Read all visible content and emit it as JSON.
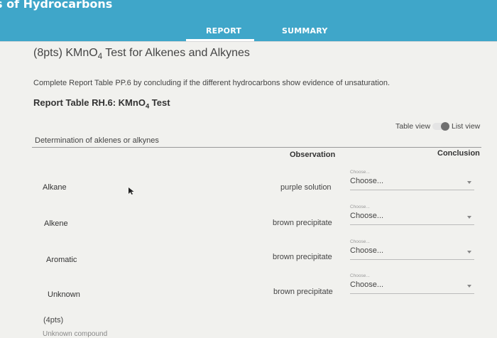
{
  "app": {
    "title": "s of Hydrocarbons"
  },
  "tabs": [
    {
      "label": "REPORT",
      "active": true
    },
    {
      "label": "SUMMARY",
      "active": false
    }
  ],
  "question": {
    "title_prefix": "(8pts) KMnO",
    "title_sub": "4",
    "title_suffix": " Test for Alkenes and Alkynes",
    "instruction": "Complete Report Table PP.6 by concluding if the different hydrocarbons show evidence of unsaturation."
  },
  "report_table": {
    "title_prefix": "Report Table RH.6: KMnO",
    "title_sub": "4",
    "title_suffix": " Test",
    "view_toggle": {
      "table_view_label": "Table view",
      "list_view_label": "List view"
    },
    "determination_label": "Determination of aklenes or alkynes",
    "columns": {
      "observation": "Observation",
      "conclusion": "Conclusion"
    },
    "rows": [
      {
        "label": "Alkane",
        "observation": "purple solution",
        "select_hint": "Choose...",
        "select_value": "Choose..."
      },
      {
        "label": "Alkene",
        "observation": "brown precipitate",
        "select_hint": "Choose...",
        "select_value": "Choose..."
      },
      {
        "label": "Aromatic",
        "observation": "brown precipitate",
        "select_hint": "Choose...",
        "select_value": "Choose..."
      },
      {
        "label": "Unknown",
        "observation": "brown precipitate",
        "select_hint": "Choose...",
        "select_value": "Choose..."
      }
    ]
  },
  "next_section": {
    "points": "(4pts)",
    "cutoff_text": "Unknown compound"
  },
  "colors": {
    "header": "#3fa6c9",
    "background": "#f1f1ee"
  }
}
